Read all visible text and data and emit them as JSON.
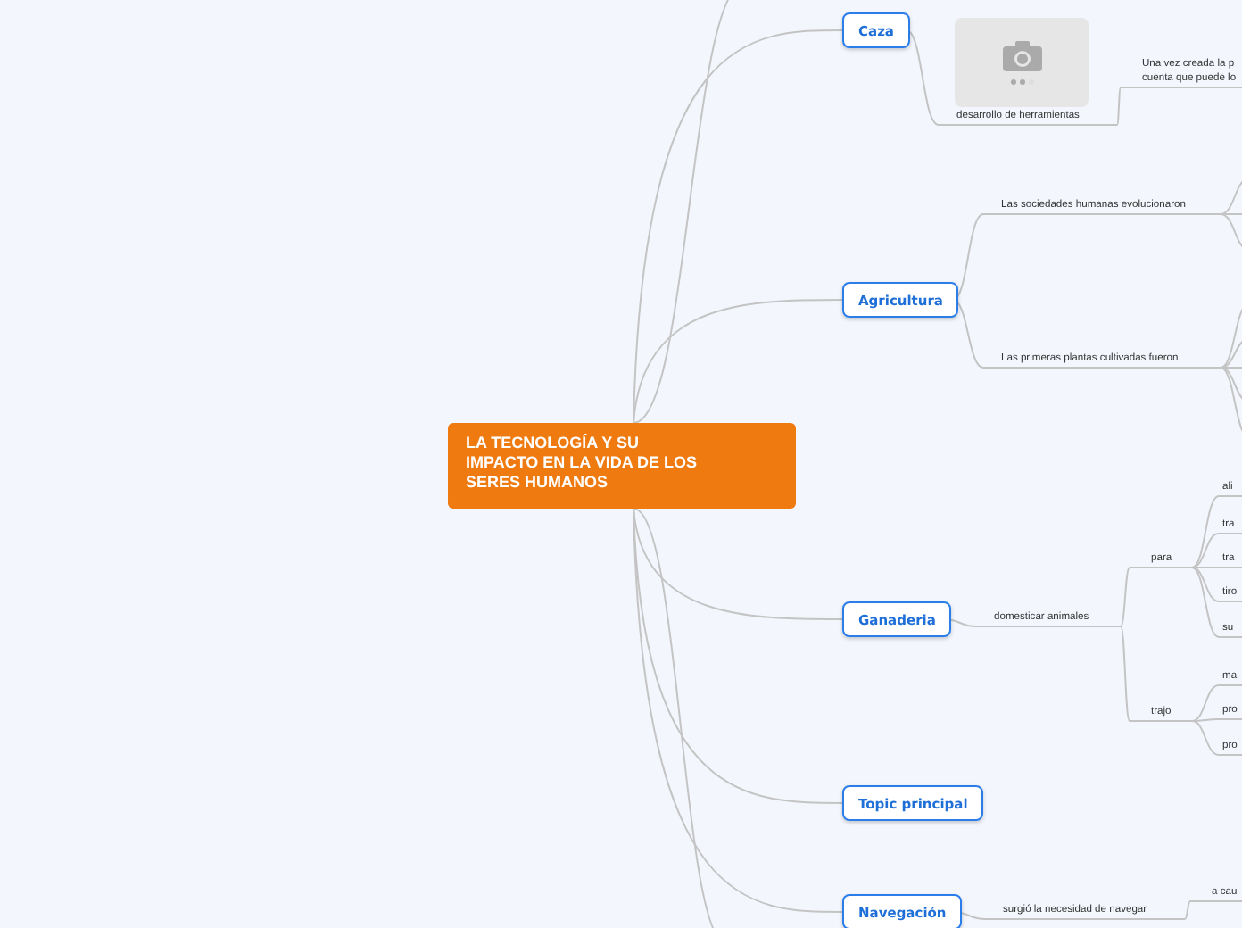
{
  "central": {
    "title": "LA TECNOLOGÍA Y SU IMPACTO EN LA VIDA DE LOS SERES HUMANOS"
  },
  "topics": [
    {
      "label": "Caza",
      "children": [
        {
          "kind": "image",
          "label": "desarrollo de herramientas",
          "children": [
            {
              "lines": [
                "Una vez creada la p",
                "cuenta que puede lo"
              ]
            }
          ]
        }
      ]
    },
    {
      "label": "Agricultura",
      "children": [
        {
          "kind": "text",
          "label": "Las sociedades humanas evolucionaron"
        },
        {
          "kind": "text",
          "label": "Las primeras plantas cultivadas fueron"
        }
      ]
    },
    {
      "label": "Ganaderia",
      "children": [
        {
          "kind": "text",
          "label": "domesticar animales",
          "children": [
            {
              "lines": [
                "para"
              ],
              "children": [
                "ali",
                "tra",
                "tra",
                "tiro",
                "su"
              ]
            },
            {
              "lines": [
                "trajo"
              ],
              "children": [
                "ma",
                "pro",
                "pro"
              ]
            }
          ]
        }
      ]
    },
    {
      "label": "Topic principal"
    },
    {
      "label": "Navegación",
      "children": [
        {
          "kind": "text",
          "label": "surgió la necesidad de navegar",
          "children": [
            {
              "lines": [
                "a cau"
              ]
            }
          ]
        }
      ]
    }
  ]
}
